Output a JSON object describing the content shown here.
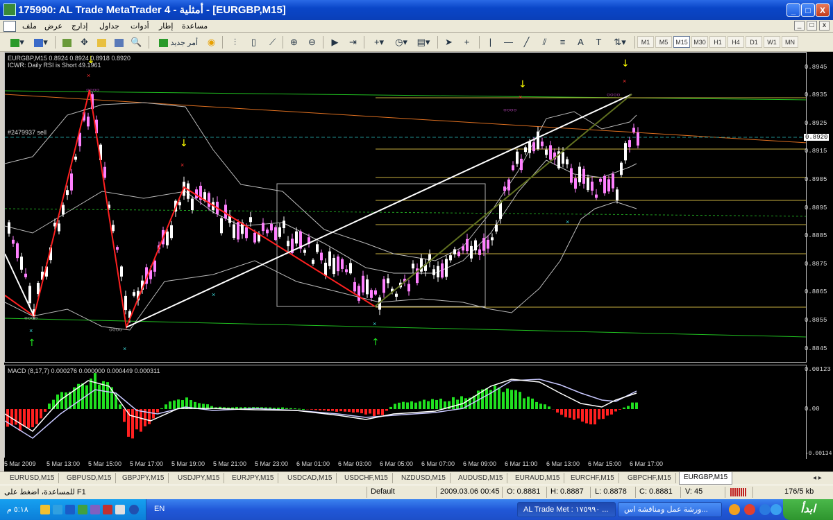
{
  "window": {
    "title": "175990: AL Trade MetaTrader 4 - أمثلية - [EURGBP,M15]",
    "buttons": {
      "minimize": "_",
      "maximize": "□",
      "close": "X"
    }
  },
  "menu": {
    "items": [
      "ملف",
      "عرض",
      "إدارج",
      "جداول",
      "أدوات",
      "إطار",
      "مساعدة"
    ],
    "mdi": [
      "_",
      "□",
      "x"
    ]
  },
  "toolbar": {
    "new_order_label": "أمر جديد",
    "timeframes": [
      "M1",
      "M5",
      "M15",
      "M30",
      "H1",
      "H4",
      "D1",
      "W1",
      "MN"
    ],
    "active_timeframe": "M15"
  },
  "chart": {
    "header": "EURGBP,M15  0.8924 0.8924 0.8918 0.8920",
    "indicator_note": "ICWR: Daily RSI is Short 49.1961",
    "order_label": "#2479937 sell",
    "current_price": "0.8920",
    "price_labels": [
      "0.8945",
      "0.8935",
      "0.8925",
      "0.8920",
      "0.8915",
      "0.8905",
      "0.8895",
      "0.8885",
      "0.8875",
      "0.8865",
      "0.8855",
      "0.8845"
    ],
    "macd_header": "MACD  (8,17,7) 0.000276 0.000000 0.000449 0.000311",
    "macd_labels": [
      "0.00123",
      "0.00",
      "-0.00134"
    ],
    "time_labels": [
      "5 Mar 2009",
      "5 Mar 13:00",
      "5 Mar 15:00",
      "5 Mar 17:00",
      "5 Mar 19:00",
      "5 Mar 21:00",
      "5 Mar 23:00",
      "6 Mar 01:00",
      "6 Mar 03:00",
      "6 Mar 05:00",
      "6 Mar 07:00",
      "6 Mar 09:00",
      "6 Mar 11:00",
      "6 Mar 13:00",
      "6 Mar 15:00",
      "6 Mar 17:00"
    ],
    "colors": {
      "bull": "#ff80ff",
      "bear": "#ffffff",
      "zigzag": "#ff2020",
      "trend": "#ffffff",
      "hist_up": "#20e020",
      "hist_down": "#ff2020"
    }
  },
  "tabs": [
    "EURUSD,M15",
    "GBPUSD,M15",
    "GBPJPY,M15",
    "USDJPY,M15",
    "EURJPY,M15",
    "USDCAD,M15",
    "USDCHF,M15",
    "NZDUSD,M15",
    "AUDUSD,M15",
    "EURAUD,M15",
    "EURCHF,M15",
    "GBPCHF,M15",
    "EURGBP,M15"
  ],
  "active_tab": "EURGBP,M15",
  "status": {
    "help": "للمساعدة، اضغط على F1",
    "profile": "Default",
    "datetime": "2009.03.06 00:45",
    "open": "O: 0.8881",
    "high": "H: 0.8887",
    "low": "L: 0.8878",
    "close": "C: 0.8881",
    "volume": "V: 45",
    "traffic": "176/5 kb"
  },
  "taskbar": {
    "clock": "٥:١٨ م",
    "lang": "EN",
    "tasks": [
      "AL Trade Met : ١٧٥٩٩٠ ...",
      "ورشة عمل ومناقشة اس..."
    ],
    "start_label": "ابدأ"
  }
}
